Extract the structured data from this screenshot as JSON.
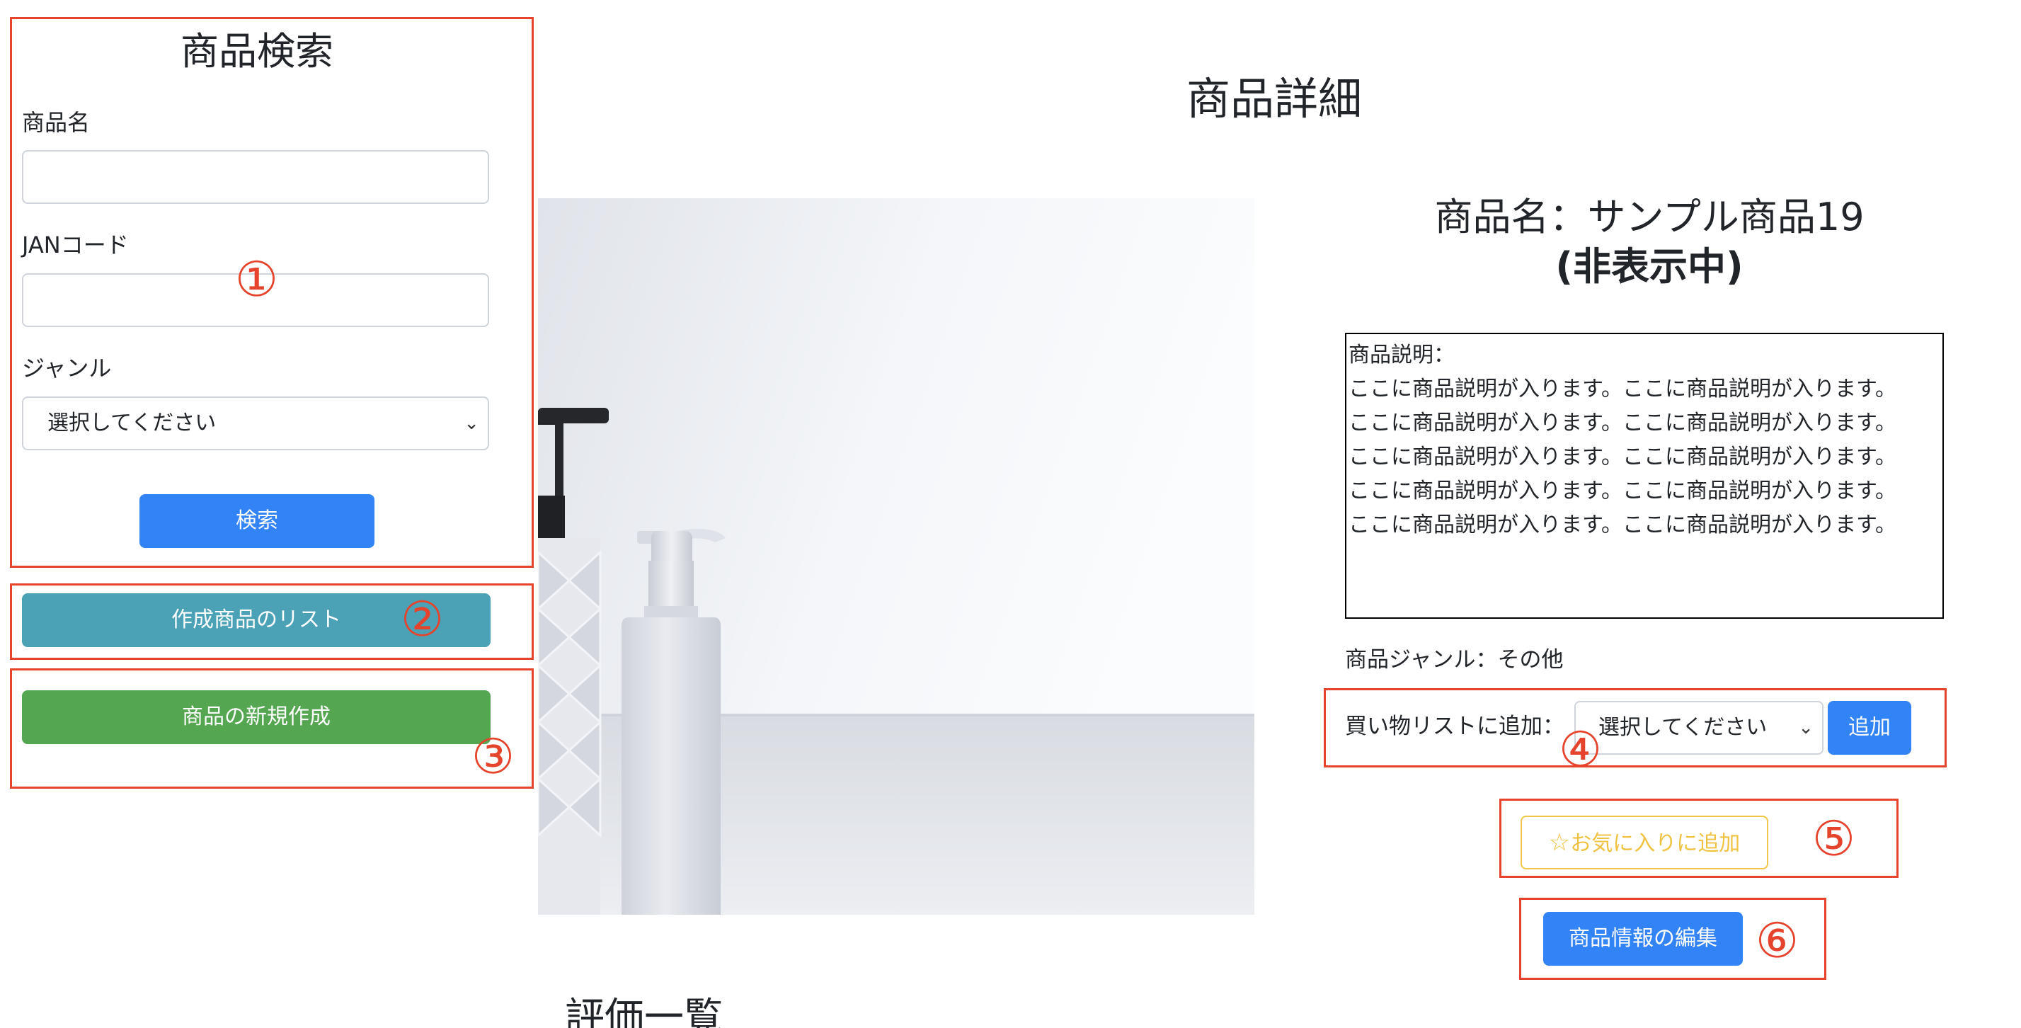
{
  "search": {
    "title": "商品検索",
    "name_label": "商品名",
    "name_value": "",
    "jan_label": "JANコード",
    "jan_value": "",
    "genre_label": "ジャンル",
    "genre_selected": "選択してください",
    "submit_label": "検索"
  },
  "actions": {
    "list_label": "作成商品のリスト",
    "create_label": "商品の新規作成"
  },
  "page": {
    "title": "商品詳細"
  },
  "product": {
    "name": "商品名：サンプル商品19",
    "status": "(非表示中)",
    "description_label": "商品説明：",
    "description_lines": [
      "ここに商品説明が入ります。ここに商品説明が入ります。",
      "ここに商品説明が入ります。ここに商品説明が入ります。",
      "ここに商品説明が入ります。ここに商品説明が入ります。",
      "ここに商品説明が入ります。ここに商品説明が入ります。",
      "ここに商品説明が入ります。ここに商品説明が入ります。"
    ],
    "genre_text": "商品ジャンル：その他",
    "image_icon": "product-bottles-photo"
  },
  "shopping_list": {
    "label": "買い物リストに追加：",
    "selected": "選択してください",
    "add_label": "追加"
  },
  "favorite": {
    "label": "お気に入りに追加",
    "icon": "star-outline-icon"
  },
  "edit": {
    "label": "商品情報の編集"
  },
  "reviews": {
    "title": "評価一覧"
  },
  "annotations": [
    "①",
    "②",
    "③",
    "④",
    "⑤",
    "⑥"
  ],
  "colors": {
    "annotation_red": "#e5432b",
    "primary": "#3283f6",
    "teal": "#4ba2b7",
    "green": "#54a650",
    "warning": "#f0c242"
  }
}
